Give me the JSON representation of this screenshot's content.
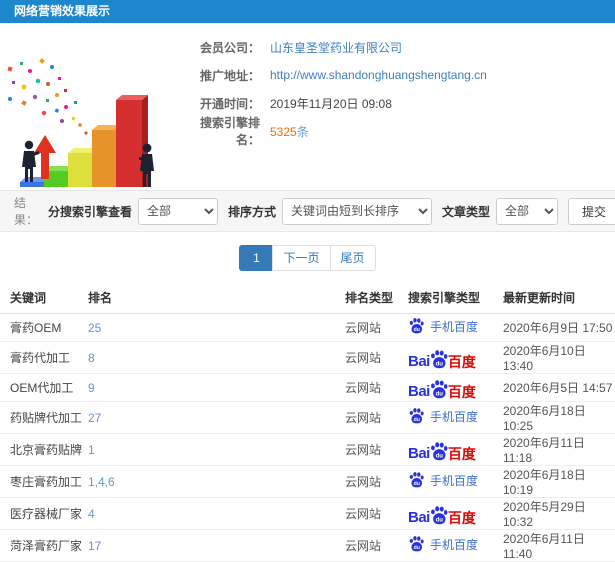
{
  "header": {
    "title": "网络营销效果展示"
  },
  "info": {
    "rows": [
      {
        "label": "会员公司：",
        "value": "山东皇圣堂药业有限公司"
      },
      {
        "label": "推广地址：",
        "value": "http://www.shandonghuangshengtang.cn"
      },
      {
        "label": "开通时间：",
        "value": "2019年11月20日 09:08"
      },
      {
        "label": "搜索引擎排名：",
        "value": "5325",
        "suffix": "条"
      }
    ]
  },
  "filter": {
    "result_label": "结果：",
    "engine_filter_label": "分搜索引擎查看",
    "engine_filter_value": "全部",
    "sort_label": "排序方式",
    "sort_value": "关键词由短到长排序",
    "article_label": "文章类型",
    "article_value": "全部",
    "submit_label": "提交"
  },
  "pagination": {
    "current": "1",
    "next": "下一页",
    "last": "尾页"
  },
  "baidu_logo": {
    "bai": "Bai",
    "du": "du"
  },
  "table": {
    "headers": [
      "关键词",
      "排名",
      "排名类型",
      "搜索引擎类型",
      "最新更新时间"
    ],
    "rows": [
      {
        "keyword": "膏药OEM",
        "rank": "25",
        "rank_type": "云网站",
        "engine": "手机百度",
        "engine_kind": "mobile-baidu",
        "updated": "2020年6月9日 17:50"
      },
      {
        "keyword": "膏药代加工",
        "rank": "8",
        "rank_type": "云网站",
        "engine": "百度",
        "engine_kind": "baidu",
        "updated": "2020年6月10日 13:40"
      },
      {
        "keyword": "OEM代加工",
        "rank": "9",
        "rank_type": "云网站",
        "engine": "百度",
        "engine_kind": "baidu",
        "updated": "2020年6月5日 14:57"
      },
      {
        "keyword": "药贴牌代加工",
        "rank": "27",
        "rank_type": "云网站",
        "engine": "手机百度",
        "engine_kind": "mobile-baidu",
        "updated": "2020年6月18日 10:25"
      },
      {
        "keyword": "北京膏药贴牌",
        "rank": "1",
        "rank_type": "云网站",
        "engine": "百度",
        "engine_kind": "baidu",
        "updated": "2020年6月11日 11:18"
      },
      {
        "keyword": "枣庄膏药加工",
        "rank": "1,4,6",
        "rank_type": "云网站",
        "engine": "手机百度",
        "engine_kind": "mobile-baidu",
        "updated": "2020年6月18日 10:19"
      },
      {
        "keyword": "医疗器械厂家",
        "rank": "4",
        "rank_type": "云网站",
        "engine": "百度",
        "engine_kind": "baidu",
        "updated": "2020年5月29日 10:32"
      },
      {
        "keyword": "菏泽膏药厂家",
        "rank": "17",
        "rank_type": "云网站",
        "engine": "手机百度",
        "engine_kind": "mobile-baidu",
        "updated": "2020年6月11日 11:40"
      }
    ]
  },
  "colors": {
    "header_blue": "#1c87cd",
    "link_blue": "#3e7fc1",
    "accent_orange": "#ff6a00",
    "baidu_blue": "#2932e1",
    "baidu_red": "#e10602",
    "active_page_blue": "#337ab7"
  }
}
